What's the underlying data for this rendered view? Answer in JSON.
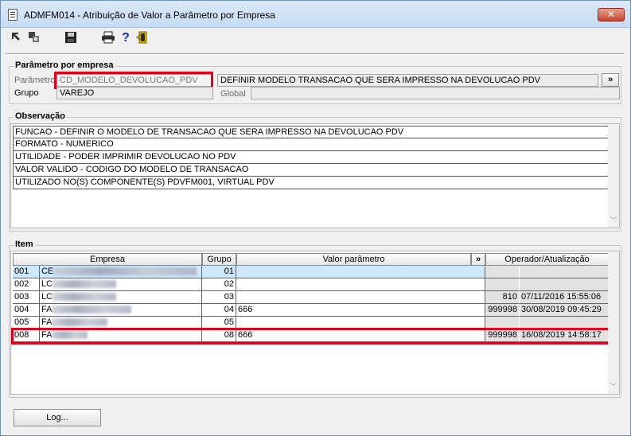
{
  "window": {
    "title": "ADMFM014 - Atribuição de Valor a Parâmetro por Empresa",
    "close_label": "✕"
  },
  "toolbar": {
    "icons": [
      "select-icon",
      "copy-icon",
      "save-icon",
      "print-icon",
      "help-icon",
      "exit-door-icon"
    ],
    "help_label": "?"
  },
  "parametro_section": {
    "legend": "Parâmetro por empresa",
    "parametro_label": "Parâmetro",
    "parametro_value": "CD_MODELO_DEVOLUCAO_PDV",
    "descricao_value": "DEFINIR MODELO TRANSACAO QUE SERA IMPRESSO NA DEVOLUCAO PDV",
    "expand_label": "»",
    "grupo_label": "Grupo",
    "grupo_value": "VAREJO",
    "global_label": "Global",
    "global_value": ""
  },
  "observacao_section": {
    "legend": "Observação",
    "lines": [
      "FUNCAO - DEFINIR O MODELO DE TRANSACAO QUE SERA IMPRESSO NA DEVOLUCAO PDV",
      "FORMATO - NUMERICO",
      "UTILIDADE - PODER IMPRIMIR DEVOLUCAO NO PDV",
      "VALOR VALIDO - CODIGO DO MODELO DE TRANSACAO",
      "UTILIZADO NO(S) COMPONENTE(S) PDVFM001, VIRTUAL PDV"
    ]
  },
  "item_section": {
    "legend": "Item",
    "columns": {
      "empresa": "Empresa",
      "grupo": "Grupo",
      "valor": "Valor parâmetro",
      "expand": "»",
      "operador": "Operador/Atualização"
    },
    "rows": [
      {
        "code": "001",
        "name": "CE",
        "grupo": "01",
        "valor": "",
        "operador": "",
        "data": ""
      },
      {
        "code": "002",
        "name": "LC",
        "grupo": "02",
        "valor": "",
        "operador": "",
        "data": ""
      },
      {
        "code": "003",
        "name": "LC",
        "grupo": "03",
        "valor": "",
        "operador": "810",
        "data": "07/11/2016 15:55:06"
      },
      {
        "code": "004",
        "name": "FA",
        "grupo": "04",
        "valor": "666",
        "operador": "999998",
        "data": "30/08/2019 09:45:29"
      },
      {
        "code": "005",
        "name": "FA",
        "grupo": "05",
        "valor": "",
        "operador": "",
        "data": ""
      },
      {
        "code": "008",
        "name": "FA",
        "grupo": "08",
        "valor": "666",
        "operador": "999998",
        "data": "16/08/2019 14:58:17"
      }
    ]
  },
  "footer": {
    "log_label": "Log..."
  },
  "colors": {
    "highlight_red": "#e0001b",
    "selected_row": "#cfe8fb"
  }
}
